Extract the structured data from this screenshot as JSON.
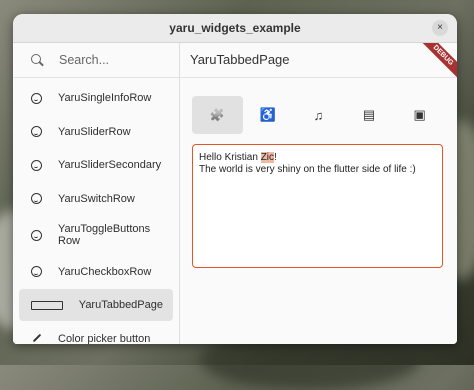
{
  "window": {
    "title": "yaru_widgets_example",
    "close_glyph": "×"
  },
  "sidebar": {
    "search_placeholder": "Search...",
    "items": [
      {
        "label": "YaruSingleInfoRow",
        "icon": "smiley-icon"
      },
      {
        "label": "YaruSliderRow",
        "icon": "smiley-icon"
      },
      {
        "label": "YaruSliderSecondary",
        "icon": "smiley-icon"
      },
      {
        "label": "YaruSwitchRow",
        "icon": "smiley-icon"
      },
      {
        "label": "YaruToggleButtonsRow",
        "icon": "smiley-icon"
      },
      {
        "label": "YaruCheckboxRow",
        "icon": "smiley-icon"
      },
      {
        "label": "YaruTabbedPage",
        "icon": "tab-icon",
        "active": true
      },
      {
        "label": "Color picker button",
        "icon": "color-picker-icon"
      }
    ]
  },
  "main": {
    "title": "YaruTabbedPage",
    "debug_banner": "DEBUG",
    "tabs": [
      {
        "icon": "puzzle-icon",
        "glyph": "🧩",
        "active": true
      },
      {
        "icon": "accessibility-icon",
        "glyph": "♿"
      },
      {
        "icon": "music-icon",
        "glyph": "♫"
      },
      {
        "icon": "contact-icon",
        "glyph": "▤"
      },
      {
        "icon": "tv-icon",
        "glyph": "▣"
      }
    ],
    "textarea": {
      "line1_prefix": "Hello Kristian ",
      "line1_highlight": "Zic",
      "line1_suffix": "!",
      "line2": "The world is very shiny on the flutter side of life :)"
    }
  },
  "colors": {
    "accent": "#e2572a",
    "debug_banner": "#a83232"
  }
}
